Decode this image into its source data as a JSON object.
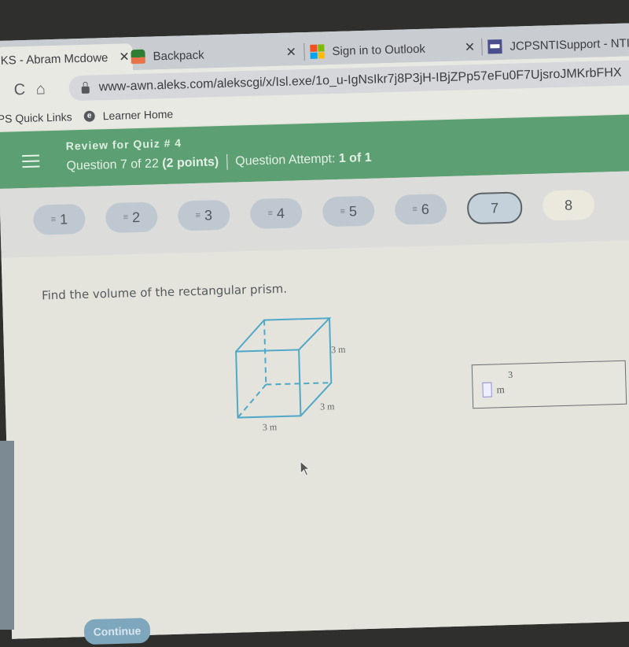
{
  "browser": {
    "tabs": [
      {
        "label": "KS - Abram Mcdowe",
        "active": true,
        "favicon": "aleks-icon"
      },
      {
        "label": "Backpack",
        "active": false,
        "favicon": "backpack-icon"
      },
      {
        "label": "Sign in to Outlook",
        "active": false,
        "favicon": "microsoft-icon"
      },
      {
        "label": "JCPSNTISupport - NTI",
        "active": false,
        "favicon": "jcps-icon"
      }
    ],
    "close_glyph": "✕",
    "reload_glyph": "C",
    "home_glyph": "⌂",
    "url": "www-awn.aleks.com/alekscgi/x/Isl.exe/1o_u-IgNsIkr7j8P3jH-IBjZPp57eFu0F7UjsroJMKrbFHX",
    "bookmarks": [
      {
        "label": "PS Quick Links"
      },
      {
        "label": "Learner Home",
        "icon": "e"
      }
    ]
  },
  "header": {
    "title": "Review for Quiz # 4",
    "question_prefix": "Question 7 of 22 ",
    "points": "(2 points)",
    "attempt_prefix": "Question Attempt: ",
    "attempt_value": "1 of 1",
    "accent_color": "#5b9f73"
  },
  "question_nav": [
    {
      "number": "1",
      "state": "answered",
      "mark": "≡"
    },
    {
      "number": "2",
      "state": "answered",
      "mark": "≡"
    },
    {
      "number": "3",
      "state": "answered",
      "mark": "≡"
    },
    {
      "number": "4",
      "state": "answered",
      "mark": "≡"
    },
    {
      "number": "5",
      "state": "answered",
      "mark": "≡"
    },
    {
      "number": "6",
      "state": "answered",
      "mark": "≡"
    },
    {
      "number": "7",
      "state": "current",
      "mark": ""
    },
    {
      "number": "8",
      "state": "unanswered",
      "mark": ""
    }
  ],
  "question": {
    "prompt": "Find the volume of the rectangular prism.",
    "figure": {
      "shape": "rectangular prism",
      "height_label": "3 m",
      "depth_label": "3 m",
      "width_label": "3 m",
      "line_color": "#4fa8c8"
    },
    "answer": {
      "value": "",
      "unit": "m",
      "exponent": "3"
    }
  },
  "continue_label": "Continue"
}
